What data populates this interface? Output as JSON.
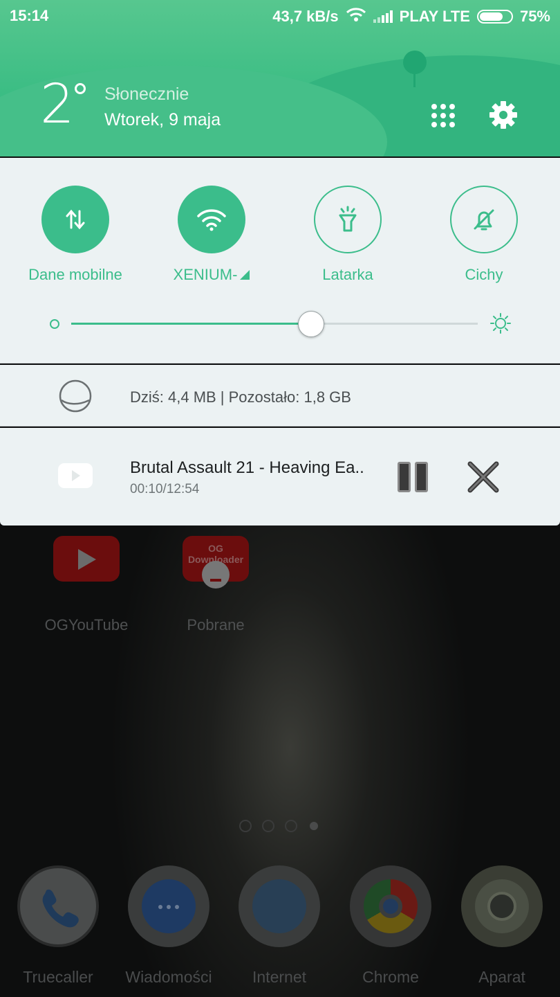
{
  "status_bar": {
    "time": "15:14",
    "speed": "43,7 kB/s",
    "carrier": "PLAY LTE",
    "battery": "75%",
    "battery_level": 0.75
  },
  "header": {
    "temperature": "2",
    "condition": "Słonecznie",
    "date": "Wtorek, 9 maja",
    "accent_color": "#3bbd8b"
  },
  "quick_settings": {
    "tiles": [
      {
        "label": "Dane mobilne",
        "state": "on",
        "icon": "mobile-data-icon"
      },
      {
        "label": "XENIUM-",
        "state": "on",
        "icon": "wifi-icon"
      },
      {
        "label": "Latarka",
        "state": "off",
        "icon": "flashlight-icon"
      },
      {
        "label": "Cichy",
        "state": "off",
        "icon": "bell-off-icon"
      }
    ],
    "brightness_level": 0.59
  },
  "data_usage": {
    "text": "Dziś: 4,4 MB | Pozostało: 1,8 GB"
  },
  "media": {
    "title": "Brutal Assault 21 - Heaving Ea..",
    "time": "00:10/12:54"
  },
  "home": {
    "apps": [
      {
        "label": "OGYouTube",
        "icon": "youtube-icon"
      },
      {
        "label": "Pobrane",
        "icon": "downloader-icon",
        "badge": "OG Downloader"
      }
    ],
    "page_indicator": {
      "count": 4,
      "active": 4
    },
    "dock": [
      {
        "label": "Truecaller",
        "icon": "phone-icon"
      },
      {
        "label": "Wiadomości",
        "icon": "messages-icon"
      },
      {
        "label": "Internet",
        "icon": "internet-icon"
      },
      {
        "label": "Chrome",
        "icon": "chrome-icon"
      },
      {
        "label": "Aparat",
        "icon": "camera-icon"
      }
    ]
  }
}
